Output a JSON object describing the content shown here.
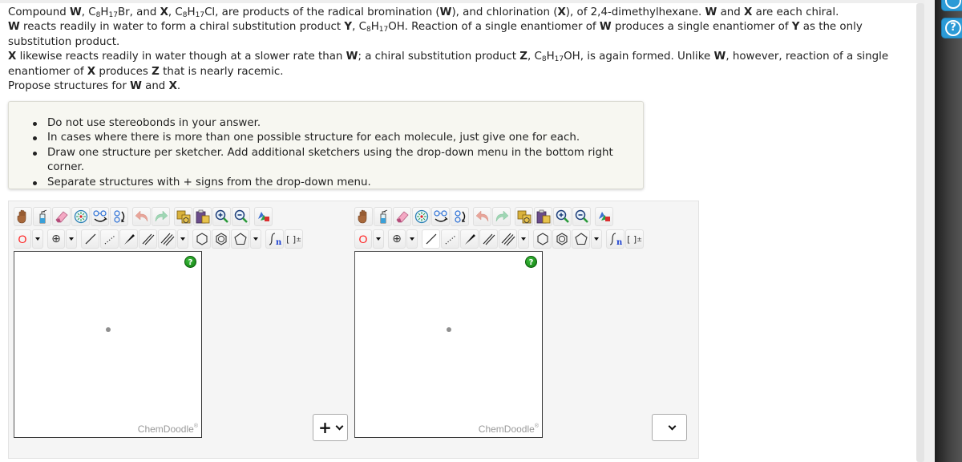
{
  "question": {
    "lines": [
      {
        "segments": [
          {
            "t": "Compound "
          },
          {
            "t": "W",
            "b": true
          },
          {
            "t": ", C"
          },
          {
            "t": "8",
            "sub": true
          },
          {
            "t": "H"
          },
          {
            "t": "17",
            "sub": true
          },
          {
            "t": "Br, and "
          },
          {
            "t": "X",
            "b": true
          },
          {
            "t": ", C"
          },
          {
            "t": "8",
            "sub": true
          },
          {
            "t": "H"
          },
          {
            "t": "17",
            "sub": true
          },
          {
            "t": "Cl, are products of the radical bromination ("
          },
          {
            "t": "W",
            "b": true
          },
          {
            "t": "), and chlorination ("
          },
          {
            "t": "X",
            "b": true
          },
          {
            "t": "), of 2,4-dimethylhexane. "
          },
          {
            "t": "W",
            "b": true
          },
          {
            "t": " and "
          },
          {
            "t": "X",
            "b": true
          },
          {
            "t": " are each chiral."
          }
        ]
      },
      {
        "segments": [
          {
            "t": "W",
            "b": true
          },
          {
            "t": " reacts readily in water to form a chiral substitution product "
          },
          {
            "t": "Y",
            "b": true
          },
          {
            "t": ", C"
          },
          {
            "t": "8",
            "sub": true
          },
          {
            "t": "H"
          },
          {
            "t": "17",
            "sub": true
          },
          {
            "t": "OH. Reaction of a single enantiomer of "
          },
          {
            "t": "W",
            "b": true
          },
          {
            "t": " produces a single enantiomer of "
          },
          {
            "t": "Y",
            "b": true
          },
          {
            "t": " as the only substitution product."
          }
        ]
      },
      {
        "segments": [
          {
            "t": "X",
            "b": true
          },
          {
            "t": " likewise reacts readily in water though at a slower rate than "
          },
          {
            "t": "W",
            "b": true
          },
          {
            "t": "; a chiral substitution product "
          },
          {
            "t": "Z",
            "b": true
          },
          {
            "t": ", C"
          },
          {
            "t": "8",
            "sub": true
          },
          {
            "t": "H"
          },
          {
            "t": "17",
            "sub": true
          },
          {
            "t": "OH, is again formed. Unlike "
          },
          {
            "t": "W",
            "b": true
          },
          {
            "t": ", however, reaction of a single enantiomer of "
          },
          {
            "t": "X",
            "b": true
          },
          {
            "t": " produces "
          },
          {
            "t": "Z",
            "b": true
          },
          {
            "t": " that is nearly racemic."
          }
        ]
      },
      {
        "segments": [
          {
            "t": "Propose structures for "
          },
          {
            "t": "W",
            "b": true
          },
          {
            "t": " and "
          },
          {
            "t": "X",
            "b": true
          },
          {
            "t": "."
          }
        ]
      }
    ]
  },
  "instructions": [
    "Do not use stereobonds in your answer.",
    "In cases where there is more than one possible structure for each molecule, just give one for each.",
    "Draw one structure per sketcher. Add additional sketchers using the drop-down menu in the bottom right corner.",
    "Separate structures with + signs from the drop-down menu."
  ],
  "toolbar": {
    "row1": [
      "hand-pan",
      "flask-clear",
      "eraser",
      "center",
      "flip-horizontal",
      "rotate",
      "undo",
      "redo",
      "copy",
      "paste",
      "zoom-in",
      "zoom-out",
      "clean-structure"
    ],
    "row2": [
      "atom-label",
      "charge",
      "single-bond",
      "dashed-bond",
      "wedge-bond",
      "double-bond",
      "triple-bond",
      "cyclohexane",
      "benzene",
      "cyclopentane",
      "sgroup",
      "bracket-charge"
    ],
    "atom_label": "O",
    "charge_symbol": "⊕",
    "sgroup_sub": "n",
    "bracket_label": "[ ]",
    "bracket_sup": "±"
  },
  "sketchers": [
    {
      "watermark": "ChemDoodle",
      "trademark": "®",
      "help": "?",
      "separator_value": "+",
      "active_tool": null
    },
    {
      "watermark": "ChemDoodle",
      "trademark": "®",
      "help": "?",
      "separator_value": "",
      "active_tool": "single-bond"
    }
  ],
  "rail": {
    "help": "?"
  },
  "colors": {
    "atom_red": "#ff2222",
    "help_green": "#119911",
    "rail_blue": "#2b9ad6"
  }
}
